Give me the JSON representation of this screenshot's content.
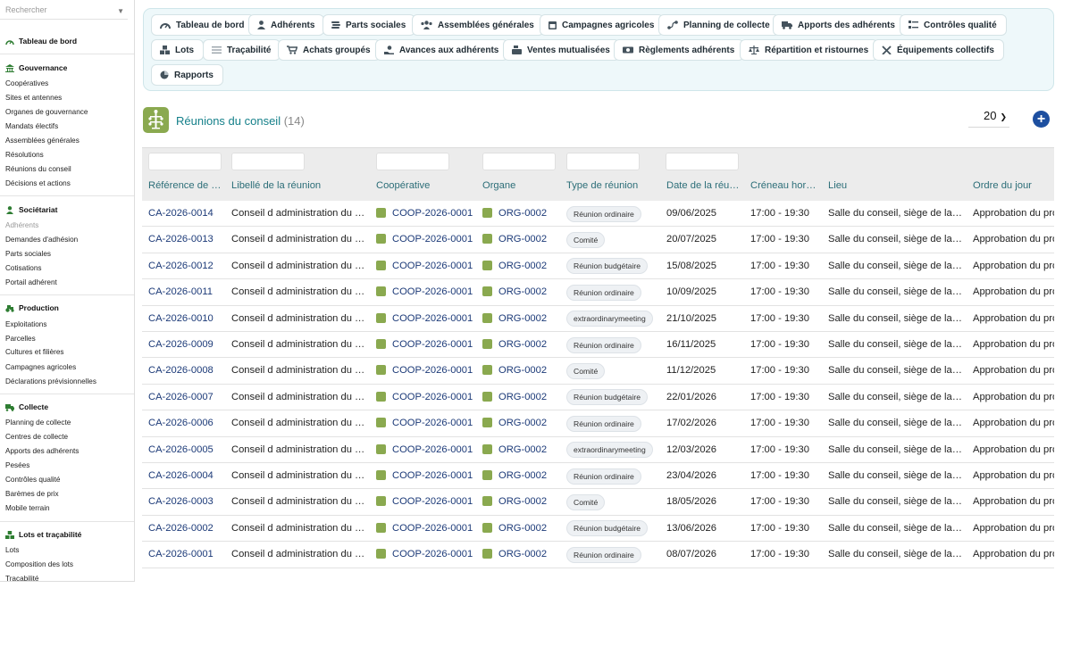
{
  "sidebar": {
    "search_placeholder": "Rechercher",
    "dashboard": "Tableau de bord",
    "sections": [
      {
        "title": "Gouvernance",
        "items": [
          "Coopératives",
          "Sites et antennes",
          "Organes de gouvernance",
          "Mandats électifs",
          "Assemblées générales",
          "Résolutions",
          "Réunions du conseil",
          "Décisions et actions"
        ]
      },
      {
        "title": "Sociétariat",
        "items": [
          "Adhérents",
          "Demandes d'adhésion",
          "Parts sociales",
          "Cotisations",
          "Portail adhérent"
        ]
      },
      {
        "title": "Production",
        "items": [
          "Exploitations",
          "Parcelles",
          "Cultures et filières",
          "Campagnes agricoles",
          "Déclarations prévisionnelles"
        ]
      },
      {
        "title": "Collecte",
        "items": [
          "Planning de collecte",
          "Centres de collecte",
          "Apports des adhérents",
          "Pesées",
          "Contrôles qualité",
          "Barèmes de prix",
          "Mobile terrain"
        ]
      },
      {
        "title": "Lots et traçabilité",
        "items": [
          "Lots",
          "Composition des lots",
          "Traçabilité"
        ]
      }
    ]
  },
  "topnav": [
    {
      "label": "Tableau de bord",
      "icon": "gauge-icon"
    },
    {
      "label": "Adhérents",
      "icon": "person-icon"
    },
    {
      "label": "Parts sociales",
      "icon": "coins-icon"
    },
    {
      "label": "Assemblées générales",
      "icon": "users-icon"
    },
    {
      "label": "Campagnes agricoles",
      "icon": "calendar-icon"
    },
    {
      "label": "Planning de collecte",
      "icon": "route-icon"
    },
    {
      "label": "Apports des adhérents",
      "icon": "truck-icon"
    },
    {
      "label": "Contrôles qualité",
      "icon": "checklist-icon"
    },
    {
      "label": "Lots",
      "icon": "boxes-icon"
    },
    {
      "label": "Traçabilité",
      "icon": "list-icon"
    },
    {
      "label": "Achats groupés",
      "icon": "cart-icon"
    },
    {
      "label": "Avances aux adhérents",
      "icon": "hand-coin-icon"
    },
    {
      "label": "Ventes mutualisées",
      "icon": "cash-register-icon"
    },
    {
      "label": "Règlements adhérents",
      "icon": "money-icon"
    },
    {
      "label": "Répartition et ristournes",
      "icon": "scale-icon"
    },
    {
      "label": "Équipements collectifs",
      "icon": "tools-icon"
    },
    {
      "label": "Rapports",
      "icon": "pie-icon"
    }
  ],
  "header": {
    "title": "Réunions du conseil",
    "count": "(14)",
    "page_size": "20"
  },
  "columns": [
    "Référence de …",
    "Libellé de la réunion",
    "Coopérative",
    "Organe",
    "Type de réunion",
    "Date de la réu…",
    "Créneau hor…",
    "Lieu",
    "Ordre du jour"
  ],
  "rows": [
    {
      "ref": "CA-2026-0014",
      "label": "Conseil d administration du …",
      "coop": "COOP-2026-0001",
      "organ": "ORG-0002",
      "type": "Réunion ordinaire",
      "date": "09/06/2025",
      "slot": "17:00 - 19:30",
      "place": "Salle du conseil, siège de la…",
      "agenda": "Approbation du pro"
    },
    {
      "ref": "CA-2026-0013",
      "label": "Conseil d administration du …",
      "coop": "COOP-2026-0001",
      "organ": "ORG-0002",
      "type": "Comité",
      "date": "20/07/2025",
      "slot": "17:00 - 19:30",
      "place": "Salle du conseil, siège de la…",
      "agenda": "Approbation du pro"
    },
    {
      "ref": "CA-2026-0012",
      "label": "Conseil d administration du …",
      "coop": "COOP-2026-0001",
      "organ": "ORG-0002",
      "type": "Réunion budgétaire",
      "date": "15/08/2025",
      "slot": "17:00 - 19:30",
      "place": "Salle du conseil, siège de la…",
      "agenda": "Approbation du pro"
    },
    {
      "ref": "CA-2026-0011",
      "label": "Conseil d administration du …",
      "coop": "COOP-2026-0001",
      "organ": "ORG-0002",
      "type": "Réunion ordinaire",
      "date": "10/09/2025",
      "slot": "17:00 - 19:30",
      "place": "Salle du conseil, siège de la…",
      "agenda": "Approbation du pro"
    },
    {
      "ref": "CA-2026-0010",
      "label": "Conseil d administration du …",
      "coop": "COOP-2026-0001",
      "organ": "ORG-0002",
      "type": "extraordinarymeeting",
      "date": "21/10/2025",
      "slot": "17:00 - 19:30",
      "place": "Salle du conseil, siège de la…",
      "agenda": "Approbation du pro"
    },
    {
      "ref": "CA-2026-0009",
      "label": "Conseil d administration du …",
      "coop": "COOP-2026-0001",
      "organ": "ORG-0002",
      "type": "Réunion ordinaire",
      "date": "16/11/2025",
      "slot": "17:00 - 19:30",
      "place": "Salle du conseil, siège de la…",
      "agenda": "Approbation du pro"
    },
    {
      "ref": "CA-2026-0008",
      "label": "Conseil d administration du …",
      "coop": "COOP-2026-0001",
      "organ": "ORG-0002",
      "type": "Comité",
      "date": "11/12/2025",
      "slot": "17:00 - 19:30",
      "place": "Salle du conseil, siège de la…",
      "agenda": "Approbation du pro"
    },
    {
      "ref": "CA-2026-0007",
      "label": "Conseil d administration du …",
      "coop": "COOP-2026-0001",
      "organ": "ORG-0002",
      "type": "Réunion budgétaire",
      "date": "22/01/2026",
      "slot": "17:00 - 19:30",
      "place": "Salle du conseil, siège de la…",
      "agenda": "Approbation du pro"
    },
    {
      "ref": "CA-2026-0006",
      "label": "Conseil d administration du …",
      "coop": "COOP-2026-0001",
      "organ": "ORG-0002",
      "type": "Réunion ordinaire",
      "date": "17/02/2026",
      "slot": "17:00 - 19:30",
      "place": "Salle du conseil, siège de la…",
      "agenda": "Approbation du pro"
    },
    {
      "ref": "CA-2026-0005",
      "label": "Conseil d administration du …",
      "coop": "COOP-2026-0001",
      "organ": "ORG-0002",
      "type": "extraordinarymeeting",
      "date": "12/03/2026",
      "slot": "17:00 - 19:30",
      "place": "Salle du conseil, siège de la…",
      "agenda": "Approbation du pro"
    },
    {
      "ref": "CA-2026-0004",
      "label": "Conseil d administration du …",
      "coop": "COOP-2026-0001",
      "organ": "ORG-0002",
      "type": "Réunion ordinaire",
      "date": "23/04/2026",
      "slot": "17:00 - 19:30",
      "place": "Salle du conseil, siège de la…",
      "agenda": "Approbation du pro"
    },
    {
      "ref": "CA-2026-0003",
      "label": "Conseil d administration du …",
      "coop": "COOP-2026-0001",
      "organ": "ORG-0002",
      "type": "Comité",
      "date": "18/05/2026",
      "slot": "17:00 - 19:30",
      "place": "Salle du conseil, siège de la…",
      "agenda": "Approbation du pro"
    },
    {
      "ref": "CA-2026-0002",
      "label": "Conseil d administration du …",
      "coop": "COOP-2026-0001",
      "organ": "ORG-0002",
      "type": "Réunion budgétaire",
      "date": "13/06/2026",
      "slot": "17:00 - 19:30",
      "place": "Salle du conseil, siège de la…",
      "agenda": "Approbation du pro"
    },
    {
      "ref": "CA-2026-0001",
      "label": "Conseil d administration du …",
      "coop": "COOP-2026-0001",
      "organ": "ORG-0002",
      "type": "Réunion ordinaire",
      "date": "08/07/2026",
      "slot": "17:00 - 19:30",
      "place": "Salle du conseil, siège de la…",
      "agenda": "Approbation du pro"
    }
  ],
  "colors": {
    "accent": "#15808a",
    "link": "#1c3a78",
    "brand_green": "#2e7d32",
    "add_button": "#1d4fa0"
  }
}
